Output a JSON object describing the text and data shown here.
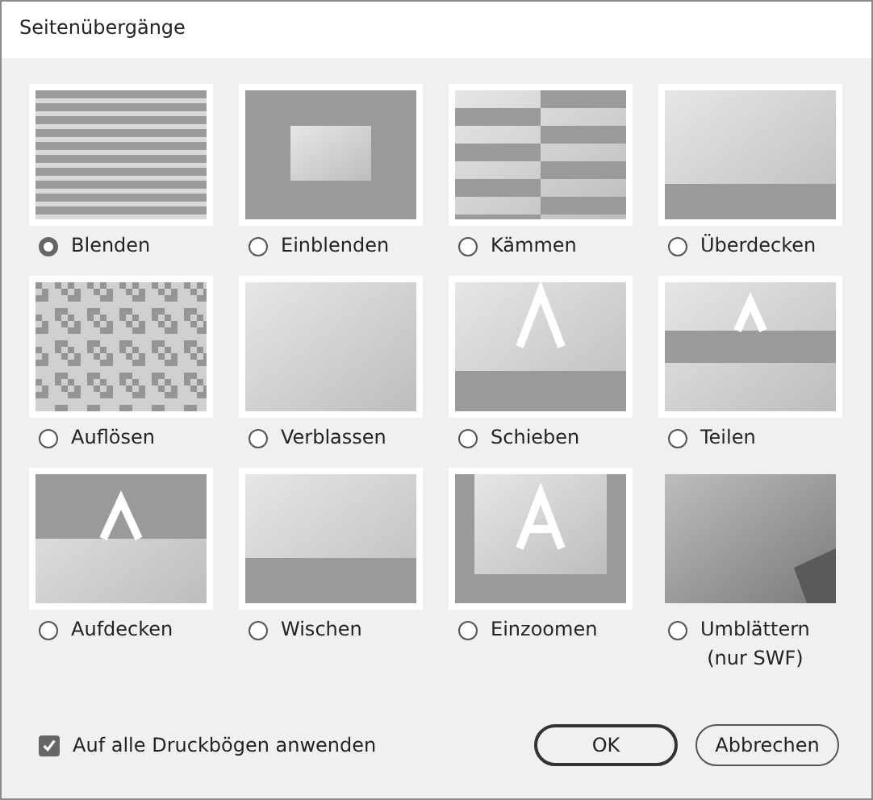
{
  "window": {
    "title": "Seitenübergänge"
  },
  "transitions": [
    {
      "kind": "blinds",
      "label": "Blenden",
      "selected": true,
      "framed": true
    },
    {
      "kind": "fadein",
      "label": "Einblenden",
      "selected": false,
      "framed": true
    },
    {
      "kind": "comb",
      "label": "Kämmen",
      "selected": false,
      "framed": true
    },
    {
      "kind": "cover",
      "label": "Überdecken",
      "selected": false,
      "framed": true
    },
    {
      "kind": "dissolve",
      "label": "Auflösen",
      "selected": false,
      "framed": true
    },
    {
      "kind": "fade",
      "label": "Verblassen",
      "selected": false,
      "framed": true
    },
    {
      "kind": "push",
      "label": "Schieben",
      "selected": false,
      "framed": true
    },
    {
      "kind": "split",
      "label": "Teilen",
      "selected": false,
      "framed": true
    },
    {
      "kind": "uncover",
      "label": "Aufdecken",
      "selected": false,
      "framed": true
    },
    {
      "kind": "wipe",
      "label": "Wischen",
      "selected": false,
      "framed": true
    },
    {
      "kind": "zoom",
      "label": "Einzoomen",
      "selected": false,
      "framed": true
    },
    {
      "kind": "pagecurl",
      "label": "Umblättern",
      "note": "(nur SWF)",
      "selected": false,
      "framed": false
    }
  ],
  "apply_all": {
    "label": "Auf alle Druckbögen anwenden",
    "checked": true
  },
  "buttons": [
    {
      "label": "OK",
      "default": true
    },
    {
      "label": "Abbrechen",
      "default": false
    }
  ]
}
